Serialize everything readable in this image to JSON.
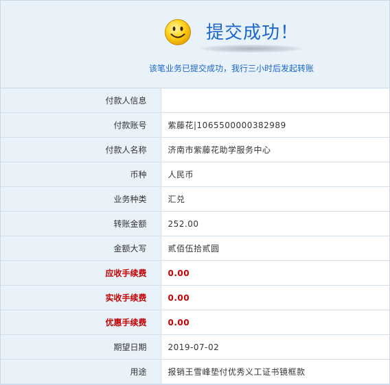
{
  "banner": {
    "icon": "smiley-face-icon",
    "title": "提交成功！",
    "message": "该笔业务已提交成功，我行三小时后发起转账"
  },
  "colors": {
    "accent": "#1a66cc",
    "label_bg": "#eaf2f9",
    "highlight": "#c40000",
    "border": "#d3dfeb"
  },
  "rows": [
    {
      "label": "付款人信息",
      "value": ""
    },
    {
      "label": "付款账号",
      "value": "紫藤花|1065500000382989"
    },
    {
      "label": "付款人名称",
      "value": "济南市紫藤花助学服务中心"
    },
    {
      "label": "币种",
      "value": "人民币"
    },
    {
      "label": "业务种类",
      "value": "汇兑"
    },
    {
      "label": "转账金额",
      "value": "252.00"
    },
    {
      "label": "金额大写",
      "value": "贰佰伍拾贰圆"
    },
    {
      "label": "应收手续费",
      "value": "0.00"
    },
    {
      "label": "实收手续费",
      "value": "0.00"
    },
    {
      "label": "优惠手续费",
      "value": "0.00"
    },
    {
      "label": "期望日期",
      "value": "2019-07-02"
    },
    {
      "label": "用途",
      "value": "报销王雪峰垫付优秀义工证书镜框款"
    }
  ]
}
